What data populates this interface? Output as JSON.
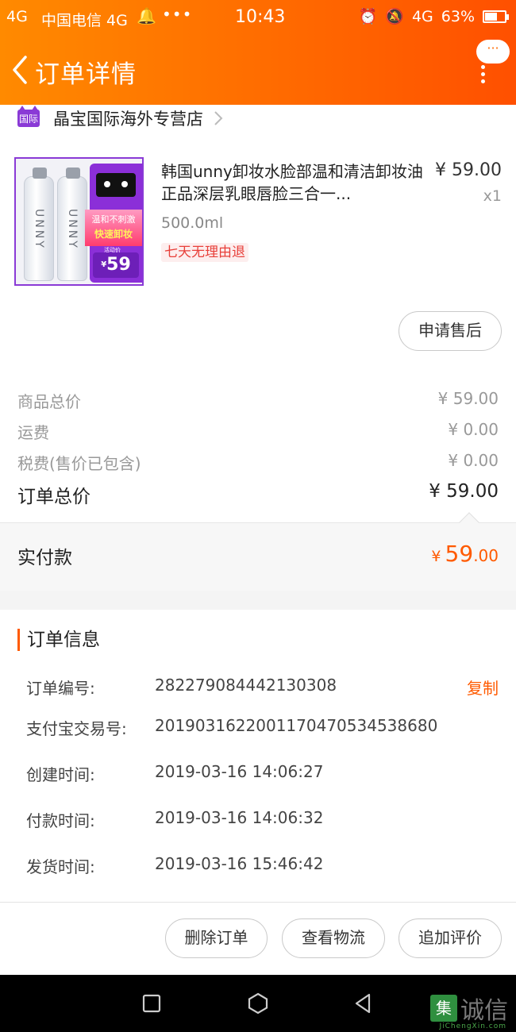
{
  "status_bar": {
    "signal": "4G",
    "carrier": "中国电信 4G",
    "time": "10:43",
    "network": "4G",
    "battery_percent": "63%",
    "battery_level": 0.63
  },
  "header": {
    "title": "订单详情",
    "menu_bubble": "···"
  },
  "shop": {
    "badge": "国际",
    "name": "晶宝国际海外专营店"
  },
  "product": {
    "title": "韩国unny卸妆水脸部温和清洁卸妆油正品深层乳眼唇脸三合一...",
    "spec": "500.0ml",
    "tag": "七天无理由退",
    "price": "¥ 59.00",
    "qty": "x1",
    "image": {
      "brand": "UNNY",
      "promo_line1": "温和不刺激",
      "promo_line2": "快速卸妆",
      "promo_note": "活动价",
      "promo_price": "59",
      "currency": "¥"
    }
  },
  "after_sale_button": "申请售后",
  "summary": {
    "goods_total_label": "商品总价",
    "goods_total_value": "¥ 59.00",
    "shipping_label": "运费",
    "shipping_value": "¥ 0.00",
    "tax_label": "税费(售价已包含)",
    "tax_value": "¥ 0.00",
    "order_total_label": "订单总价",
    "order_total_value": "¥ 59.00"
  },
  "payment": {
    "label": "实付款",
    "currency": "¥",
    "amount_int": "59",
    "amount_dec": ".00"
  },
  "order_info": {
    "title": "订单信息",
    "copy_label": "复制",
    "rows": [
      {
        "key": "订单编号:",
        "value": "282279084442130308"
      },
      {
        "key": "支付宝交易号:",
        "value": "2019031622001170470534538680"
      },
      {
        "key": "创建时间:",
        "value": "2019-03-16 14:06:27"
      },
      {
        "key": "付款时间:",
        "value": "2019-03-16 14:06:32"
      },
      {
        "key": "发货时间:",
        "value": "2019-03-16 15:46:42"
      }
    ]
  },
  "actions": {
    "delete_order": "删除订单",
    "view_logistics": "查看物流",
    "add_review": "追加评价"
  },
  "watermark": {
    "logo_char": "集",
    "text": "诚信",
    "sub": "JiChengXin.com"
  },
  "colors": {
    "header_start": "#ff8a00",
    "header_end": "#ff5000",
    "accent": "#ff5a00",
    "tag_red": "#e8403a",
    "shop_purple": "#8a3ad6"
  }
}
